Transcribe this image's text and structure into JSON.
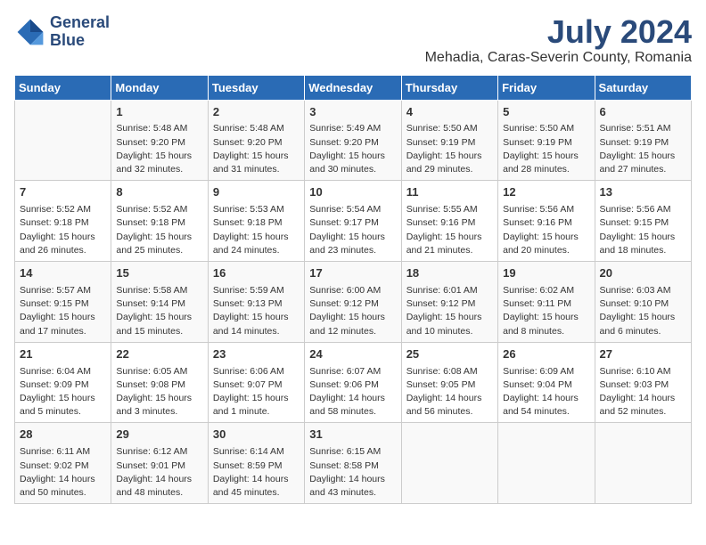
{
  "logo": {
    "line1": "General",
    "line2": "Blue"
  },
  "title": "July 2024",
  "subtitle": "Mehadia, Caras-Severin County, Romania",
  "days_of_week": [
    "Sunday",
    "Monday",
    "Tuesday",
    "Wednesday",
    "Thursday",
    "Friday",
    "Saturday"
  ],
  "weeks": [
    [
      {
        "day": "",
        "info": ""
      },
      {
        "day": "1",
        "info": "Sunrise: 5:48 AM\nSunset: 9:20 PM\nDaylight: 15 hours\nand 32 minutes."
      },
      {
        "day": "2",
        "info": "Sunrise: 5:48 AM\nSunset: 9:20 PM\nDaylight: 15 hours\nand 31 minutes."
      },
      {
        "day": "3",
        "info": "Sunrise: 5:49 AM\nSunset: 9:20 PM\nDaylight: 15 hours\nand 30 minutes."
      },
      {
        "day": "4",
        "info": "Sunrise: 5:50 AM\nSunset: 9:19 PM\nDaylight: 15 hours\nand 29 minutes."
      },
      {
        "day": "5",
        "info": "Sunrise: 5:50 AM\nSunset: 9:19 PM\nDaylight: 15 hours\nand 28 minutes."
      },
      {
        "day": "6",
        "info": "Sunrise: 5:51 AM\nSunset: 9:19 PM\nDaylight: 15 hours\nand 27 minutes."
      }
    ],
    [
      {
        "day": "7",
        "info": "Sunrise: 5:52 AM\nSunset: 9:18 PM\nDaylight: 15 hours\nand 26 minutes."
      },
      {
        "day": "8",
        "info": "Sunrise: 5:52 AM\nSunset: 9:18 PM\nDaylight: 15 hours\nand 25 minutes."
      },
      {
        "day": "9",
        "info": "Sunrise: 5:53 AM\nSunset: 9:18 PM\nDaylight: 15 hours\nand 24 minutes."
      },
      {
        "day": "10",
        "info": "Sunrise: 5:54 AM\nSunset: 9:17 PM\nDaylight: 15 hours\nand 23 minutes."
      },
      {
        "day": "11",
        "info": "Sunrise: 5:55 AM\nSunset: 9:16 PM\nDaylight: 15 hours\nand 21 minutes."
      },
      {
        "day": "12",
        "info": "Sunrise: 5:56 AM\nSunset: 9:16 PM\nDaylight: 15 hours\nand 20 minutes."
      },
      {
        "day": "13",
        "info": "Sunrise: 5:56 AM\nSunset: 9:15 PM\nDaylight: 15 hours\nand 18 minutes."
      }
    ],
    [
      {
        "day": "14",
        "info": "Sunrise: 5:57 AM\nSunset: 9:15 PM\nDaylight: 15 hours\nand 17 minutes."
      },
      {
        "day": "15",
        "info": "Sunrise: 5:58 AM\nSunset: 9:14 PM\nDaylight: 15 hours\nand 15 minutes."
      },
      {
        "day": "16",
        "info": "Sunrise: 5:59 AM\nSunset: 9:13 PM\nDaylight: 15 hours\nand 14 minutes."
      },
      {
        "day": "17",
        "info": "Sunrise: 6:00 AM\nSunset: 9:12 PM\nDaylight: 15 hours\nand 12 minutes."
      },
      {
        "day": "18",
        "info": "Sunrise: 6:01 AM\nSunset: 9:12 PM\nDaylight: 15 hours\nand 10 minutes."
      },
      {
        "day": "19",
        "info": "Sunrise: 6:02 AM\nSunset: 9:11 PM\nDaylight: 15 hours\nand 8 minutes."
      },
      {
        "day": "20",
        "info": "Sunrise: 6:03 AM\nSunset: 9:10 PM\nDaylight: 15 hours\nand 6 minutes."
      }
    ],
    [
      {
        "day": "21",
        "info": "Sunrise: 6:04 AM\nSunset: 9:09 PM\nDaylight: 15 hours\nand 5 minutes."
      },
      {
        "day": "22",
        "info": "Sunrise: 6:05 AM\nSunset: 9:08 PM\nDaylight: 15 hours\nand 3 minutes."
      },
      {
        "day": "23",
        "info": "Sunrise: 6:06 AM\nSunset: 9:07 PM\nDaylight: 15 hours\nand 1 minute."
      },
      {
        "day": "24",
        "info": "Sunrise: 6:07 AM\nSunset: 9:06 PM\nDaylight: 14 hours\nand 58 minutes."
      },
      {
        "day": "25",
        "info": "Sunrise: 6:08 AM\nSunset: 9:05 PM\nDaylight: 14 hours\nand 56 minutes."
      },
      {
        "day": "26",
        "info": "Sunrise: 6:09 AM\nSunset: 9:04 PM\nDaylight: 14 hours\nand 54 minutes."
      },
      {
        "day": "27",
        "info": "Sunrise: 6:10 AM\nSunset: 9:03 PM\nDaylight: 14 hours\nand 52 minutes."
      }
    ],
    [
      {
        "day": "28",
        "info": "Sunrise: 6:11 AM\nSunset: 9:02 PM\nDaylight: 14 hours\nand 50 minutes."
      },
      {
        "day": "29",
        "info": "Sunrise: 6:12 AM\nSunset: 9:01 PM\nDaylight: 14 hours\nand 48 minutes."
      },
      {
        "day": "30",
        "info": "Sunrise: 6:14 AM\nSunset: 8:59 PM\nDaylight: 14 hours\nand 45 minutes."
      },
      {
        "day": "31",
        "info": "Sunrise: 6:15 AM\nSunset: 8:58 PM\nDaylight: 14 hours\nand 43 minutes."
      },
      {
        "day": "",
        "info": ""
      },
      {
        "day": "",
        "info": ""
      },
      {
        "day": "",
        "info": ""
      }
    ]
  ]
}
